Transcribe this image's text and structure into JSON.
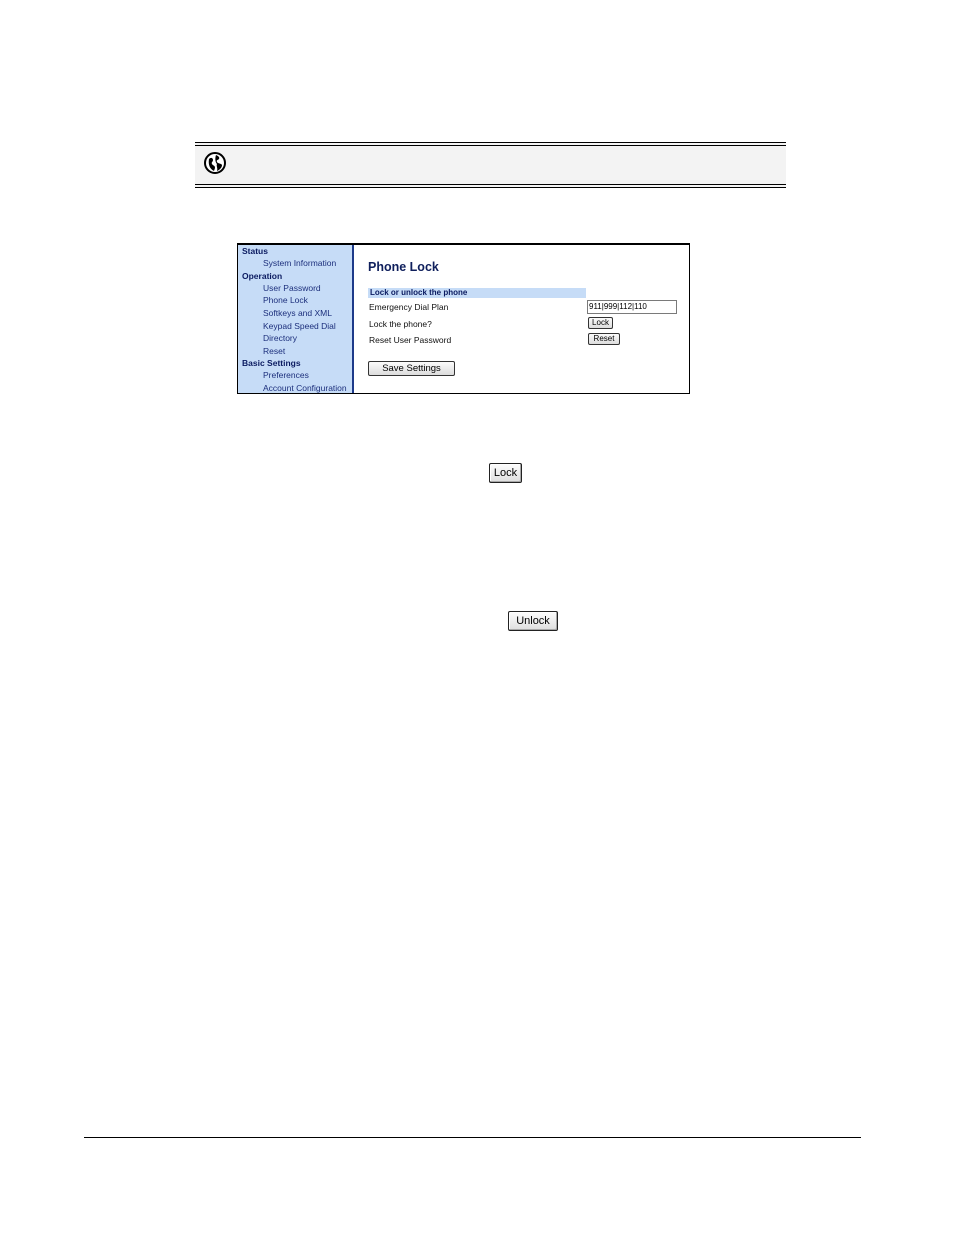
{
  "banner": {
    "icon": "globe-icon"
  },
  "webui": {
    "nav": {
      "groups": [
        {
          "label": "Status",
          "items": [
            "System Information"
          ]
        },
        {
          "label": "Operation",
          "items": [
            "User Password",
            "Phone Lock",
            "Softkeys and XML",
            "Keypad Speed Dial",
            "Directory",
            "Reset"
          ]
        },
        {
          "label": "Basic Settings",
          "items": [
            "Preferences",
            "Account Configuration"
          ]
        }
      ]
    },
    "content": {
      "title": "Phone Lock",
      "section_header": "Lock or unlock the phone",
      "emergency_label": "Emergency Dial Plan",
      "emergency_value": "911|999|112|110",
      "lock_label": "Lock the phone?",
      "lock_button": "Lock",
      "reset_label": "Reset User Password",
      "reset_button": "Reset",
      "save_button": "Save Settings"
    }
  },
  "document": {
    "lock_button": "Lock",
    "unlock_button": "Unlock"
  }
}
